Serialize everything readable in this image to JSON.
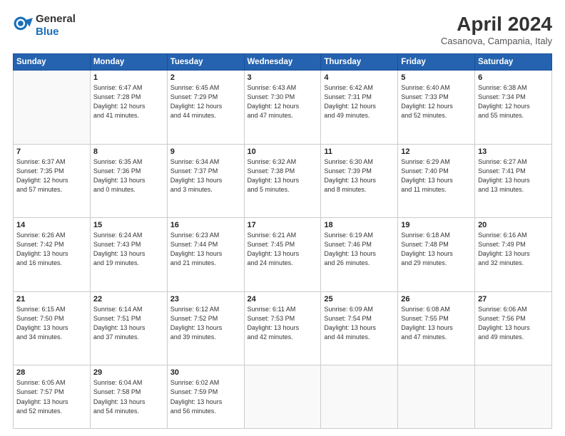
{
  "header": {
    "logo_line1": "General",
    "logo_line2": "Blue",
    "month": "April 2024",
    "location": "Casanova, Campania, Italy"
  },
  "weekdays": [
    "Sunday",
    "Monday",
    "Tuesday",
    "Wednesday",
    "Thursday",
    "Friday",
    "Saturday"
  ],
  "weeks": [
    [
      {
        "num": "",
        "info": ""
      },
      {
        "num": "1",
        "info": "Sunrise: 6:47 AM\nSunset: 7:28 PM\nDaylight: 12 hours\nand 41 minutes."
      },
      {
        "num": "2",
        "info": "Sunrise: 6:45 AM\nSunset: 7:29 PM\nDaylight: 12 hours\nand 44 minutes."
      },
      {
        "num": "3",
        "info": "Sunrise: 6:43 AM\nSunset: 7:30 PM\nDaylight: 12 hours\nand 47 minutes."
      },
      {
        "num": "4",
        "info": "Sunrise: 6:42 AM\nSunset: 7:31 PM\nDaylight: 12 hours\nand 49 minutes."
      },
      {
        "num": "5",
        "info": "Sunrise: 6:40 AM\nSunset: 7:33 PM\nDaylight: 12 hours\nand 52 minutes."
      },
      {
        "num": "6",
        "info": "Sunrise: 6:38 AM\nSunset: 7:34 PM\nDaylight: 12 hours\nand 55 minutes."
      }
    ],
    [
      {
        "num": "7",
        "info": "Sunrise: 6:37 AM\nSunset: 7:35 PM\nDaylight: 12 hours\nand 57 minutes."
      },
      {
        "num": "8",
        "info": "Sunrise: 6:35 AM\nSunset: 7:36 PM\nDaylight: 13 hours\nand 0 minutes."
      },
      {
        "num": "9",
        "info": "Sunrise: 6:34 AM\nSunset: 7:37 PM\nDaylight: 13 hours\nand 3 minutes."
      },
      {
        "num": "10",
        "info": "Sunrise: 6:32 AM\nSunset: 7:38 PM\nDaylight: 13 hours\nand 5 minutes."
      },
      {
        "num": "11",
        "info": "Sunrise: 6:30 AM\nSunset: 7:39 PM\nDaylight: 13 hours\nand 8 minutes."
      },
      {
        "num": "12",
        "info": "Sunrise: 6:29 AM\nSunset: 7:40 PM\nDaylight: 13 hours\nand 11 minutes."
      },
      {
        "num": "13",
        "info": "Sunrise: 6:27 AM\nSunset: 7:41 PM\nDaylight: 13 hours\nand 13 minutes."
      }
    ],
    [
      {
        "num": "14",
        "info": "Sunrise: 6:26 AM\nSunset: 7:42 PM\nDaylight: 13 hours\nand 16 minutes."
      },
      {
        "num": "15",
        "info": "Sunrise: 6:24 AM\nSunset: 7:43 PM\nDaylight: 13 hours\nand 19 minutes."
      },
      {
        "num": "16",
        "info": "Sunrise: 6:23 AM\nSunset: 7:44 PM\nDaylight: 13 hours\nand 21 minutes."
      },
      {
        "num": "17",
        "info": "Sunrise: 6:21 AM\nSunset: 7:45 PM\nDaylight: 13 hours\nand 24 minutes."
      },
      {
        "num": "18",
        "info": "Sunrise: 6:19 AM\nSunset: 7:46 PM\nDaylight: 13 hours\nand 26 minutes."
      },
      {
        "num": "19",
        "info": "Sunrise: 6:18 AM\nSunset: 7:48 PM\nDaylight: 13 hours\nand 29 minutes."
      },
      {
        "num": "20",
        "info": "Sunrise: 6:16 AM\nSunset: 7:49 PM\nDaylight: 13 hours\nand 32 minutes."
      }
    ],
    [
      {
        "num": "21",
        "info": "Sunrise: 6:15 AM\nSunset: 7:50 PM\nDaylight: 13 hours\nand 34 minutes."
      },
      {
        "num": "22",
        "info": "Sunrise: 6:14 AM\nSunset: 7:51 PM\nDaylight: 13 hours\nand 37 minutes."
      },
      {
        "num": "23",
        "info": "Sunrise: 6:12 AM\nSunset: 7:52 PM\nDaylight: 13 hours\nand 39 minutes."
      },
      {
        "num": "24",
        "info": "Sunrise: 6:11 AM\nSunset: 7:53 PM\nDaylight: 13 hours\nand 42 minutes."
      },
      {
        "num": "25",
        "info": "Sunrise: 6:09 AM\nSunset: 7:54 PM\nDaylight: 13 hours\nand 44 minutes."
      },
      {
        "num": "26",
        "info": "Sunrise: 6:08 AM\nSunset: 7:55 PM\nDaylight: 13 hours\nand 47 minutes."
      },
      {
        "num": "27",
        "info": "Sunrise: 6:06 AM\nSunset: 7:56 PM\nDaylight: 13 hours\nand 49 minutes."
      }
    ],
    [
      {
        "num": "28",
        "info": "Sunrise: 6:05 AM\nSunset: 7:57 PM\nDaylight: 13 hours\nand 52 minutes."
      },
      {
        "num": "29",
        "info": "Sunrise: 6:04 AM\nSunset: 7:58 PM\nDaylight: 13 hours\nand 54 minutes."
      },
      {
        "num": "30",
        "info": "Sunrise: 6:02 AM\nSunset: 7:59 PM\nDaylight: 13 hours\nand 56 minutes."
      },
      {
        "num": "",
        "info": ""
      },
      {
        "num": "",
        "info": ""
      },
      {
        "num": "",
        "info": ""
      },
      {
        "num": "",
        "info": ""
      }
    ]
  ]
}
